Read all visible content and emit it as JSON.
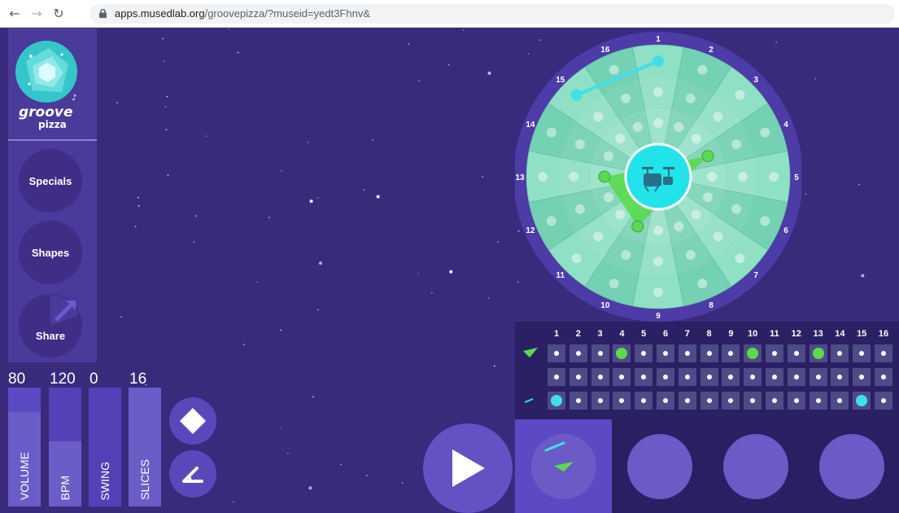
{
  "browser": {
    "url_domain": "apps.musedlab.org",
    "url_path": "/groovepizza/?museid=yedt3Fhnv&"
  },
  "logo": {
    "line1": "groove",
    "line2": "pizza"
  },
  "sidebar": {
    "specials_label": "Specials",
    "shapes_label": "Shapes",
    "share_label": "Share"
  },
  "sliders": [
    {
      "label": "VOLUME",
      "value": "80",
      "level": 0.8
    },
    {
      "label": "BPM",
      "value": "120",
      "level": 0.55
    },
    {
      "label": "SWING",
      "value": "0",
      "level": 0
    },
    {
      "label": "SLICES",
      "value": "16",
      "level": 1.0
    }
  ],
  "pizza": {
    "slice_numbers": [
      "1",
      "2",
      "3",
      "4",
      "5",
      "6",
      "7",
      "8",
      "9",
      "10",
      "11",
      "12",
      "13",
      "14",
      "15",
      "16"
    ],
    "center_icon": "drum-kit-icon",
    "colors": {
      "ring": "#4d3ba8",
      "slice_a": "#74d1b3",
      "slice_b": "#8fe0c4",
      "center": "#22e3ea",
      "kick": "#5bd94f",
      "hihat": "#40e0e8"
    },
    "active_steps": {
      "kick": [
        4,
        10,
        13
      ],
      "snare": [],
      "hihat": [
        1,
        15
      ]
    }
  },
  "grid": {
    "columns": [
      "1",
      "2",
      "3",
      "4",
      "5",
      "6",
      "7",
      "8",
      "9",
      "10",
      "11",
      "12",
      "13",
      "14",
      "15",
      "16"
    ],
    "rows": [
      {
        "instrument": "kick",
        "icon": "kick-wedge-icon",
        "active": [
          4,
          10,
          13
        ],
        "color": "#5bd94f"
      },
      {
        "instrument": "snare",
        "icon": "snare-line-icon",
        "active": [],
        "color": "#40e0e8"
      },
      {
        "instrument": "hihat",
        "icon": "hihat-line-icon",
        "active": [
          1,
          15
        ],
        "color": "#40e0e8"
      }
    ]
  },
  "tabs": {
    "active_index": 0,
    "count": 4
  },
  "colors": {
    "background": "#3a2a7c",
    "sidebar": "#4a3a9a",
    "accent": "#6551c4"
  }
}
